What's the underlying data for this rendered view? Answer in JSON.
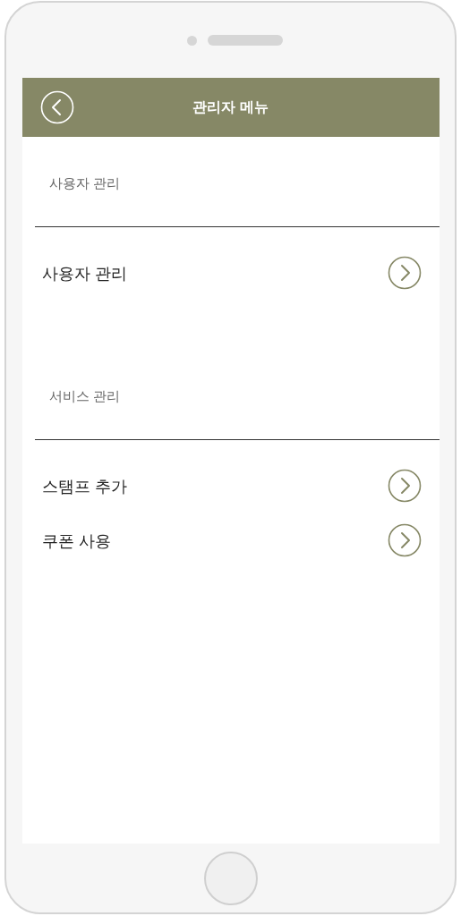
{
  "header": {
    "title": "관리자 메뉴"
  },
  "sections": [
    {
      "title": "사용자 관리",
      "items": [
        {
          "label": "사용자 관리"
        }
      ]
    },
    {
      "title": "서비스 관리",
      "items": [
        {
          "label": "스탬프 추가"
        },
        {
          "label": "쿠폰 사용"
        }
      ]
    }
  ]
}
